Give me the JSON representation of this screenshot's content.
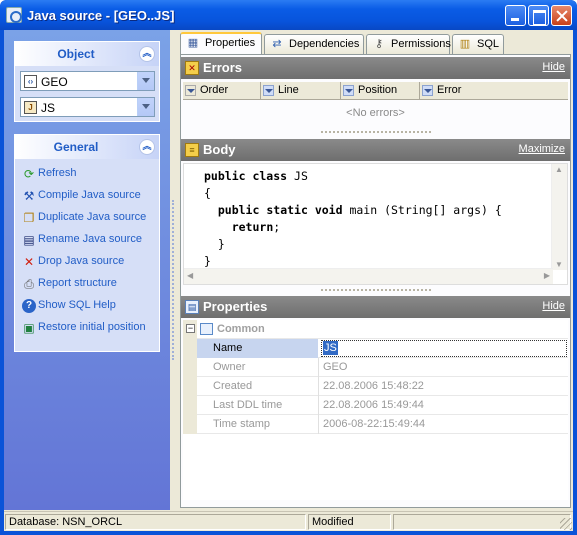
{
  "window": {
    "title": "Java source - [GEO..JS]"
  },
  "sidebar": {
    "object_panel": {
      "title": "Object",
      "combos": [
        {
          "icon": "schema-icon",
          "value": "GEO"
        },
        {
          "icon": "java-source-icon",
          "value": "JS"
        }
      ]
    },
    "general_panel": {
      "title": "General",
      "actions": [
        {
          "label": "Refresh",
          "icon": "refresh-icon"
        },
        {
          "label": "Compile Java source",
          "icon": "compile-icon"
        },
        {
          "label": "Duplicate Java source",
          "icon": "duplicate-icon"
        },
        {
          "label": "Rename Java source",
          "icon": "rename-icon"
        },
        {
          "label": "Drop Java source",
          "icon": "drop-icon"
        },
        {
          "label": "Report structure",
          "icon": "report-icon"
        },
        {
          "label": "Show SQL Help",
          "icon": "help-icon"
        },
        {
          "label": "Restore initial position",
          "icon": "restore-icon"
        }
      ]
    }
  },
  "tabs": [
    {
      "label": "Properties",
      "icon": "properties-icon",
      "active": true
    },
    {
      "label": "Dependencies",
      "icon": "dependencies-icon",
      "active": false
    },
    {
      "label": "Permissions",
      "icon": "permissions-icon",
      "active": false
    },
    {
      "label": "SQL",
      "icon": "sql-icon",
      "active": false
    }
  ],
  "errors": {
    "title": "Errors",
    "hide_label": "Hide",
    "columns": [
      "Order",
      "Line",
      "Position",
      "Error"
    ],
    "empty_text": "<No errors>"
  },
  "body": {
    "title": "Body",
    "maximize_label": "Maximize",
    "code_lines": [
      "public class JS",
      "{",
      "  public static void main (String[] args) {",
      "    return;",
      "  }",
      "}"
    ]
  },
  "properties": {
    "title": "Properties",
    "hide_label": "Hide",
    "category": "Common",
    "rows": [
      {
        "name": "Name",
        "value": "JS"
      },
      {
        "name": "Owner",
        "value": "GEO"
      },
      {
        "name": "Created",
        "value": "22.08.2006 15:48:22"
      },
      {
        "name": "Last DDL time",
        "value": "22.08.2006 15:49:44"
      },
      {
        "name": "Time stamp",
        "value": "2006-08-22:15:49:44"
      }
    ]
  },
  "statusbar": {
    "database": "Database: NSN_ORCL",
    "state": "Modified",
    "extra": ""
  }
}
